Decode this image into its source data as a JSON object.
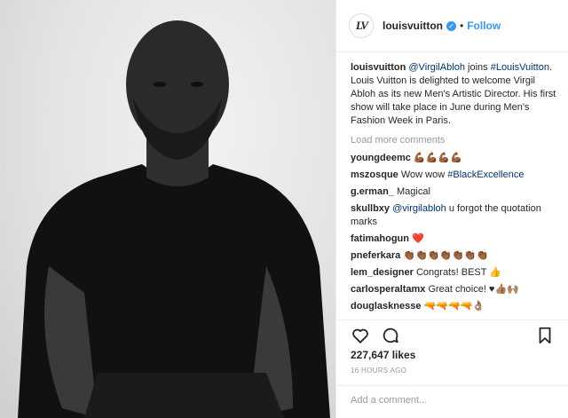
{
  "header": {
    "logo": "LV",
    "username": "louisvuitton",
    "verified": "✓",
    "separator": "•",
    "follow_label": "Follow"
  },
  "caption": {
    "user": "louisvuitton",
    "mention": "@VirgilAbloh",
    "joins": " joins ",
    "hashtag": "#LouisVuitton",
    "text": "Louis Vuitton is delighted to welcome Virgil Abloh as its new Men's Artistic Director. His first show will take place in June during Men's Fashion Week in Paris."
  },
  "load_more": "Load more comments",
  "comments": [
    {
      "user": "youngdeemc",
      "text": "💪🏾💪🏾💪🏾💪🏾"
    },
    {
      "user": "mszosque",
      "text": "Wow wow ",
      "hashtag": "#BlackExcellence"
    },
    {
      "user": "g.erman_",
      "text": "Magical"
    },
    {
      "user": "skullbxy",
      "mention": "@virgilabloh",
      "text": " u forgot the quotation marks"
    },
    {
      "user": "fatimahogun",
      "text": "❤️"
    },
    {
      "user": "pneferkara",
      "text": "👏🏾👏🏾👏🏾👏🏾👏🏾👏🏾👏🏾"
    },
    {
      "user": "lem_designer",
      "text": "Congrats! BEST 👍"
    },
    {
      "user": "carlosperaltamx",
      "text": "Great choice! ♥👍🏽🙌🏽"
    },
    {
      "user": "douglasknesse",
      "text": "🔫🔫🔫🔫👌🏽"
    }
  ],
  "likes": "227,647 likes",
  "timestamp": "16 HOURS AGO",
  "add_comment_placeholder": "Add a comment...",
  "icons": [
    "heart-icon",
    "comment-icon",
    "bookmark-icon",
    "verified-badge-icon"
  ],
  "colors": {
    "link_blue": "#3897f0",
    "hashtag_blue": "#003569",
    "muted_gray": "#999999"
  }
}
